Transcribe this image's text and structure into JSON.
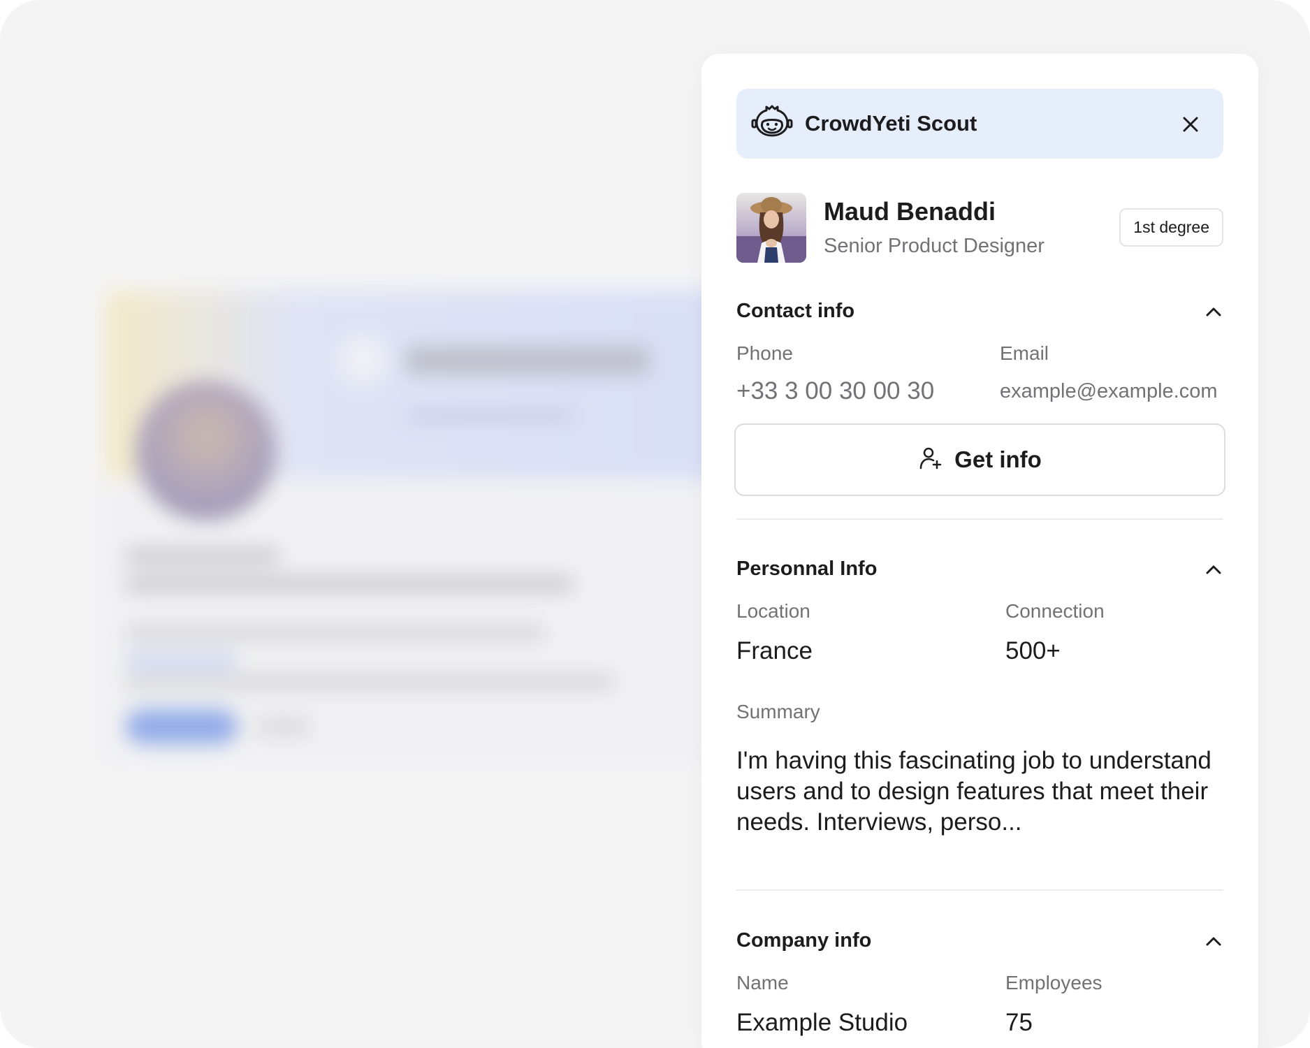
{
  "panel": {
    "app_title": "CrowdYeti Scout",
    "close_icon": "close-icon",
    "logo_icon": "yeti-logo-icon"
  },
  "profile": {
    "name": "Maud Benaddi",
    "role": "Senior Product Designer",
    "degree": "1st degree"
  },
  "contact": {
    "title": "Contact info",
    "phone_label": "Phone",
    "phone_value": "+33 3 00 30 00 30",
    "email_label": "Email",
    "email_value": "example@example.com",
    "get_info_label": "Get info"
  },
  "personal": {
    "title": "Personnal Info",
    "location_label": "Location",
    "location_value": "France",
    "connection_label": "Connection",
    "connection_value": "500+",
    "summary_label": "Summary",
    "summary_text": "I'm having this fascinating job to understand users and to design features that meet their needs. Interviews, perso..."
  },
  "company": {
    "title": "Company info",
    "name_label": "Name",
    "name_value": "Example Studio",
    "employees_label": "Employees",
    "employees_value": "75"
  },
  "colors": {
    "header_bg": "#e6edfb",
    "panel_bg": "#ffffff",
    "page_bg": "#f4f4f5",
    "muted_text": "#727276"
  }
}
